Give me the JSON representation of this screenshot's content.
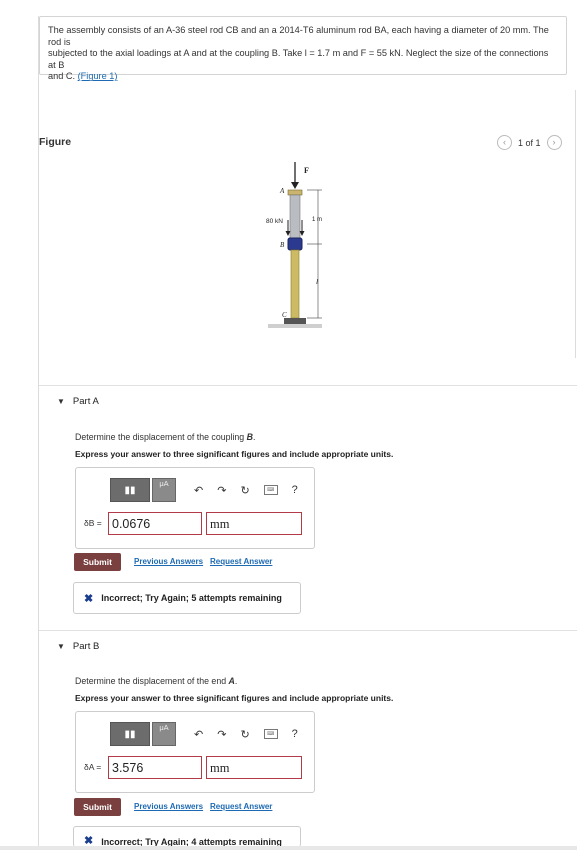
{
  "problem": {
    "text_line1": "The assembly consists of an A-36 steel rod CB and an a 2014-T6 aluminum rod BA, each having a diameter of 20 mm. The rod is",
    "text_line2": "subjected to the axial loadings at A and at the coupling B. Take l = 1.7 m and F = 55 kN. Neglect the size of the connections at B",
    "text_line3_pre": "and C. ",
    "figure_link": "(Figure 1)"
  },
  "figure": {
    "title": "Figure",
    "pager_text": "1 of 1",
    "labels": {
      "F": "F",
      "A": "A",
      "B": "B",
      "C": "C",
      "load": "80 kN",
      "length_top": "1 m",
      "length_l": "l"
    }
  },
  "part_a": {
    "header": "Part A",
    "question_pre": "Determine the displacement of the coupling ",
    "question_var": "B",
    "question_post": ".",
    "instruction": "Express your answer to three significant figures and include appropriate units.",
    "answer_label": "δB =",
    "answer_value": "0.0676",
    "unit_value": "mm",
    "submit_label": "Submit",
    "prev_answers": "Previous Answers",
    "request_answer": "Request Answer",
    "feedback": "Incorrect; Try Again; 5 attempts remaining"
  },
  "part_b": {
    "header": "Part B",
    "question_pre": "Determine the displacement of the end ",
    "question_var": "A",
    "question_post": ".",
    "instruction": "Express your answer to three significant figures and include appropriate units.",
    "answer_label": "δA =",
    "answer_value": "3.576",
    "unit_value": "mm",
    "submit_label": "Submit",
    "prev_answers": "Previous Answers",
    "request_answer": "Request Answer",
    "feedback": "Incorrect; Try Again; 4 attempts remaining"
  },
  "toolbar": {
    "templates_icon": "templates-icon",
    "greek_label": "μA",
    "help_label": "?"
  },
  "colors": {
    "submit": "#7a3f3f",
    "link": "#1d6ab3",
    "input_border": "#b33a47",
    "incorrect": "#1a3d8c"
  }
}
